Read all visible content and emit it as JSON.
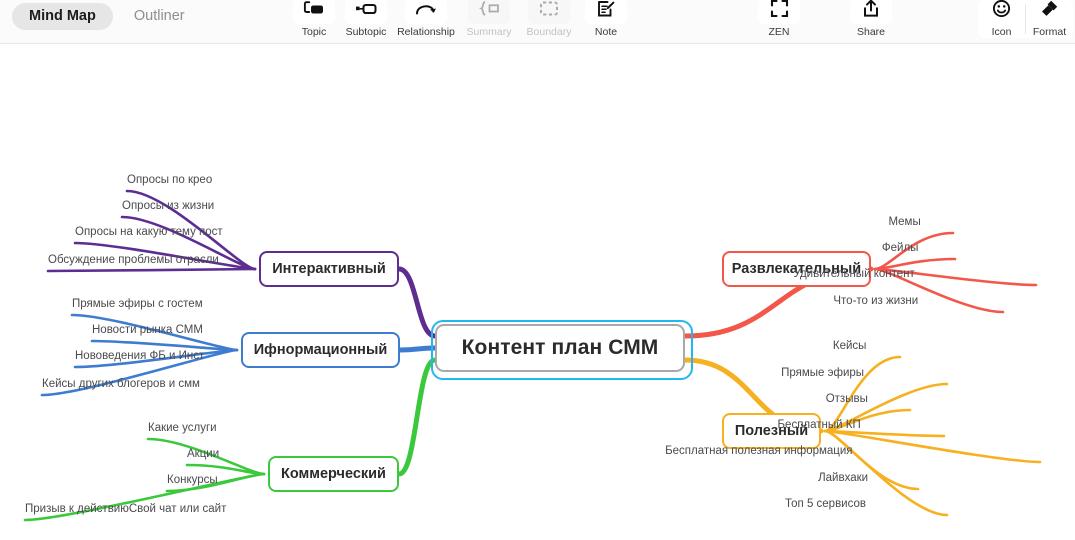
{
  "toolbar": {
    "view_tabs": [
      {
        "label": "Mind Map",
        "active": true
      },
      {
        "label": "Outliner",
        "active": false
      }
    ],
    "tools": [
      {
        "label": "Topic",
        "icon": "topic-icon",
        "disabled": false
      },
      {
        "label": "Subtopic",
        "icon": "subtopic-icon",
        "disabled": false
      },
      {
        "label": "Relationship",
        "icon": "relationship-icon",
        "disabled": false
      },
      {
        "label": "Summary",
        "icon": "summary-icon",
        "disabled": true
      },
      {
        "label": "Boundary",
        "icon": "boundary-icon",
        "disabled": true
      },
      {
        "label": "Note",
        "icon": "note-icon",
        "disabled": false
      }
    ],
    "zen": {
      "label": "ZEN",
      "icon": "zen-fullscreen-icon"
    },
    "share": {
      "label": "Share",
      "icon": "share-upload-icon"
    },
    "right_tools": [
      {
        "label": "Icon",
        "icon": "smiley-icon"
      },
      {
        "label": "Format",
        "icon": "paintbrush-icon"
      }
    ]
  },
  "mindmap": {
    "root": {
      "label": "Контент план СММ",
      "selected": true
    },
    "branches": [
      {
        "label": "Интерактивный",
        "color": "#5E2D91",
        "side": "left",
        "children": [
          "Опросы по крео",
          "Опросы из жизни",
          "Опросы на какую тему пост",
          "Обсуждение проблемы отрасли"
        ]
      },
      {
        "label": "Ифнормационный",
        "color": "#3E7CD0",
        "side": "left",
        "children": [
          "Прямые эфиры с гостем",
          "Новости рынка СММ",
          "Нововедения ФБ и Инст",
          "Кейсы других блогеров и смм"
        ]
      },
      {
        "label": "Коммерческий",
        "color": "#3CC83C",
        "side": "left",
        "children": [
          "Какие услуги",
          "Акции",
          "Конкурсы",
          "Призыв к действиюСвой чат или сайт"
        ]
      },
      {
        "label": "Развлекательный",
        "color": "#F2574A",
        "side": "right",
        "children": [
          "Мемы",
          "Фейлы",
          "Удивительный контент",
          "Что-то из жизни"
        ]
      },
      {
        "label": "Полезный",
        "color": "#F6B020",
        "side": "right",
        "children": [
          "Кейсы",
          "Прямые эфиры",
          "Отзывы",
          "Бесплатный КП",
          "Бесплатная полезная информация",
          "Лайвхаки",
          "Топ 5 сервисов"
        ]
      }
    ]
  }
}
